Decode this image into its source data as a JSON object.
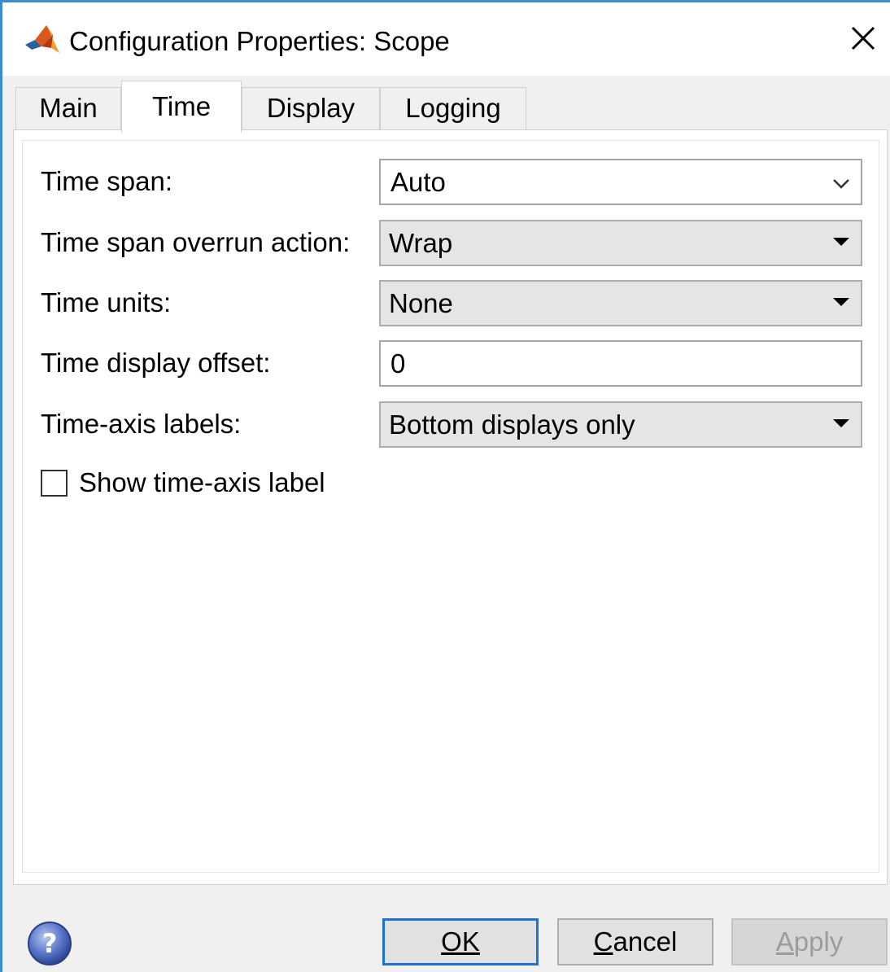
{
  "window": {
    "title": "Configuration Properties: Scope",
    "accent_color": "#3a8ad4"
  },
  "tabs": [
    {
      "label": "Main",
      "active": false
    },
    {
      "label": "Time",
      "active": true
    },
    {
      "label": "Display",
      "active": false
    },
    {
      "label": "Logging",
      "active": false
    }
  ],
  "form": {
    "time_span": {
      "label": "Time span:",
      "value": "Auto",
      "control": "editable-combo"
    },
    "overrun_action": {
      "label": "Time span overrun action:",
      "value": "Wrap",
      "control": "dropdown"
    },
    "time_units": {
      "label": "Time units:",
      "value": "None",
      "control": "dropdown"
    },
    "display_offset": {
      "label": "Time display offset:",
      "value": "0",
      "control": "text"
    },
    "axis_labels": {
      "label": "Time-axis labels:",
      "value": "Bottom displays only",
      "control": "dropdown"
    },
    "show_axis_label": {
      "label": "Show time-axis label",
      "checked": false
    }
  },
  "footer": {
    "ok_label": "OK",
    "cancel_label": "Cancel",
    "apply_label": "Apply",
    "apply_enabled": false
  },
  "icons": {
    "app": "matlab-logo-icon",
    "close": "close-icon",
    "help": "help-icon"
  }
}
